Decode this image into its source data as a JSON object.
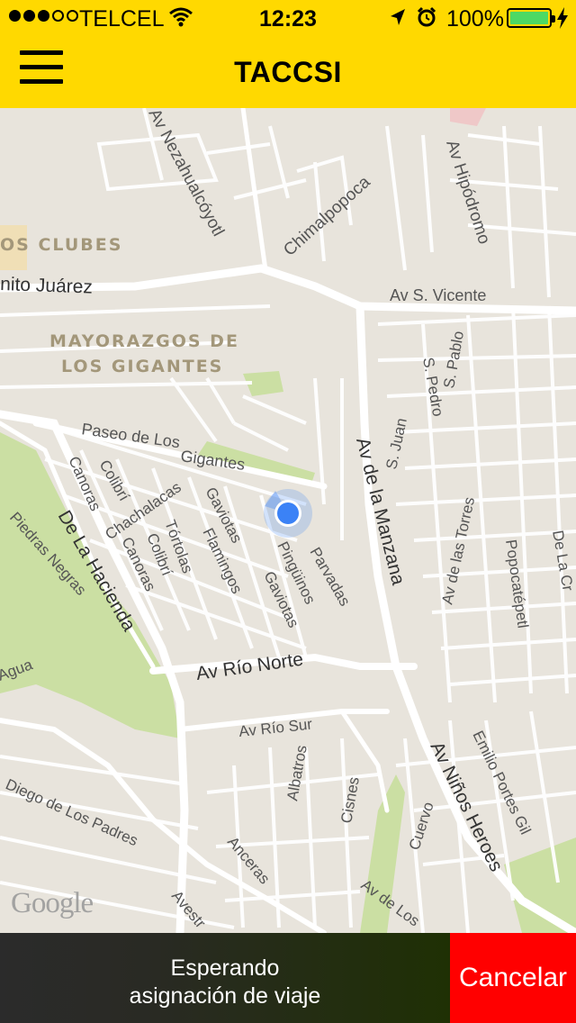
{
  "status_bar": {
    "carrier": "TELCEL",
    "signal_dots": [
      true,
      true,
      true,
      false,
      false
    ],
    "time": "12:23",
    "battery_percent": "100%",
    "battery_level": 1.0,
    "icons": [
      "wifi-icon",
      "location-arrow-icon",
      "alarm-icon",
      "battery-icon",
      "charging-bolt-icon"
    ]
  },
  "navbar": {
    "title": "TACCSI",
    "menu_icon": "hamburger-menu-icon"
  },
  "map": {
    "watermark": "Google",
    "labels": {
      "nezahualcoyotl": "Av Nezahualcóyotl",
      "chimalpopoca": "Chimalpopoca",
      "hipodromo": "Av Hipódromo",
      "clubes": "OS CLUBES",
      "juarez": "nito Juárez",
      "vicente": "Av S. Vicente",
      "mayorazgos1": "MAYORAZGOS DE",
      "mayorazgos2": "LOS GIGANTES",
      "spedro": "S. Pedro",
      "spablo": "S. Pablo",
      "sjuan": "S. Juan",
      "paseo1": "Paseo de Los",
      "paseo2": "Gigantes",
      "manzana": "Av de la Manzana",
      "canoras1": "Canoras",
      "colibri1": "Colibrí",
      "chachalacas": "Chachalacas",
      "gaviotas1": "Gaviotas",
      "canoras2": "Canoras",
      "tortolas": "Tórtolas",
      "colibri2": "Colibrí",
      "flamingos": "Flamingos",
      "pinguinos": "Pingüinos",
      "gaviotas2": "Gaviotas",
      "parvadas": "Parvadas",
      "torres": "Av de las Torres",
      "popocatepetl": "Popocatépetl",
      "delacr": "De La Cr",
      "hacienda": "De La Hacienda",
      "piedras": "Piedras Negras",
      "agua": "Agua",
      "rionorte": "Av Río Norte",
      "riosur": "Av Río Sur",
      "albatros": "Albatros",
      "cisnes": "Cisnes",
      "ninos": "Av Niños Heroes",
      "emilio": "Emilio Portes Gil",
      "cuervo": "Cuervo",
      "diego": "Diego de Los Padres",
      "anceras": "Anceras",
      "avestr": "Avestr",
      "avdelos": "Av de Los"
    }
  },
  "bottom_bar": {
    "status_line1": "Esperando",
    "status_line2": "asignación de viaje",
    "cancel_label": "Cancelar"
  },
  "colors": {
    "brand_yellow": "#ffd900",
    "cancel_red": "#ff0000",
    "location_blue": "#3b82f6",
    "map_background": "#e8e4dc",
    "map_park": "#cbdfa3"
  }
}
